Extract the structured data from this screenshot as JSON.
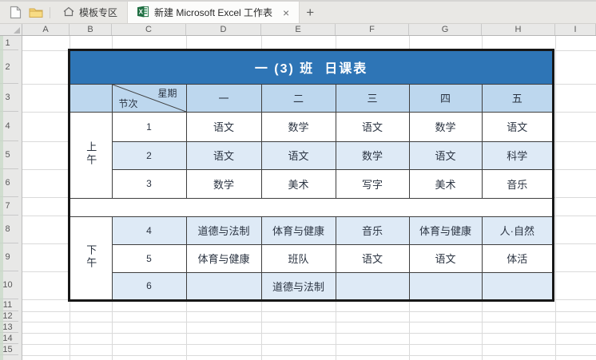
{
  "tabbar": {
    "template_tab": "模板专区",
    "workbook_tab": "新建 Microsoft Excel 工作表",
    "close_label": "×",
    "new_tab_label": "+"
  },
  "sheet": {
    "columns": [
      "A",
      "B",
      "C",
      "D",
      "E",
      "F",
      "G",
      "H",
      "I"
    ],
    "rows": [
      "1",
      "2",
      "3",
      "4",
      "5",
      "6",
      "7",
      "8",
      "9",
      "10",
      "11",
      "12",
      "13",
      "14",
      "15"
    ]
  },
  "timetable": {
    "title": "一 (3) 班  日课表",
    "corner": {
      "top_right": "星期",
      "bottom_left": "节次"
    },
    "days": [
      "一",
      "二",
      "三",
      "四",
      "五"
    ],
    "morning_label": "上午",
    "afternoon_label": "下午",
    "periods": [
      {
        "no": "1",
        "subjects": [
          "语文",
          "数学",
          "语文",
          "数学",
          "语文"
        ]
      },
      {
        "no": "2",
        "subjects": [
          "语文",
          "语文",
          "数学",
          "语文",
          "科学"
        ]
      },
      {
        "no": "3",
        "subjects": [
          "数学",
          "美术",
          "写字",
          "美术",
          "音乐"
        ]
      },
      {
        "no": "4",
        "subjects": [
          "道德与法制",
          "体育与健康",
          "音乐",
          "体育与健康",
          "人·自然"
        ]
      },
      {
        "no": "5",
        "subjects": [
          "体育与健康",
          "班队",
          "语文",
          "语文",
          "体活"
        ]
      },
      {
        "no": "6",
        "subjects": [
          "",
          "道德与法制",
          "",
          "",
          ""
        ]
      }
    ],
    "colors": {
      "title_bg": "#2E75B6",
      "header_bg": "#BDD7EE",
      "alt_row_bg": "#DEEAF6"
    }
  }
}
